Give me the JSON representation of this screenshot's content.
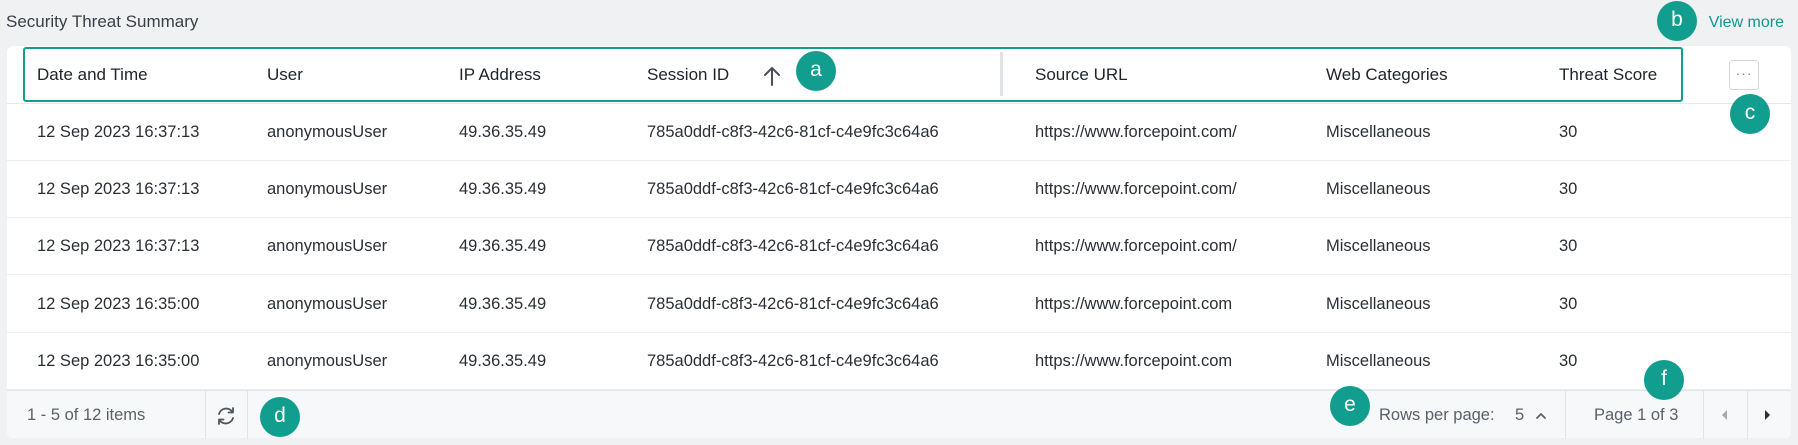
{
  "page": {
    "title": "Security Threat Summary",
    "view_more": "View more"
  },
  "table": {
    "columns": [
      "Date and Time",
      "User",
      "IP Address",
      "Session ID",
      "Source URL",
      "Web Categories",
      "Threat Score"
    ],
    "more_label": "···",
    "rows": [
      [
        "12 Sep 2023 16:37:13",
        "anonymousUser",
        "49.36.35.49",
        "785a0ddf-c8f3-42c6-81cf-c4e9fc3c64a6",
        "https://www.forcepoint.com/",
        "Miscellaneous",
        "30"
      ],
      [
        "12 Sep 2023 16:37:13",
        "anonymousUser",
        "49.36.35.49",
        "785a0ddf-c8f3-42c6-81cf-c4e9fc3c64a6",
        "https://www.forcepoint.com/",
        "Miscellaneous",
        "30"
      ],
      [
        "12 Sep 2023 16:37:13",
        "anonymousUser",
        "49.36.35.49",
        "785a0ddf-c8f3-42c6-81cf-c4e9fc3c64a6",
        "https://www.forcepoint.com/",
        "Miscellaneous",
        "30"
      ],
      [
        "12 Sep 2023 16:35:00",
        "anonymousUser",
        "49.36.35.49",
        "785a0ddf-c8f3-42c6-81cf-c4e9fc3c64a6",
        "https://www.forcepoint.com",
        "Miscellaneous",
        "30"
      ],
      [
        "12 Sep 2023 16:35:00",
        "anonymousUser",
        "49.36.35.49",
        "785a0ddf-c8f3-42c6-81cf-c4e9fc3c64a6",
        "https://www.forcepoint.com",
        "Miscellaneous",
        "30"
      ]
    ]
  },
  "footer": {
    "items_text": "1 - 5 of 12 items",
    "rows_per_page_label": "Rows per page:",
    "rows_per_page_value": "5",
    "page_text": "Page 1 of 3"
  },
  "annotations": {
    "a": "a",
    "b": "b",
    "c": "c",
    "d": "d",
    "e": "e",
    "f": "f"
  },
  "colors": {
    "accent": "#119e8e",
    "background": "#f0f1f3",
    "card": "#ffffff"
  },
  "icons": {
    "sort": "arrow-up-icon",
    "refresh": "refresh-icon",
    "rows_chevron": "chevron-up-icon",
    "prev": "caret-left-icon",
    "next": "caret-right-icon"
  }
}
